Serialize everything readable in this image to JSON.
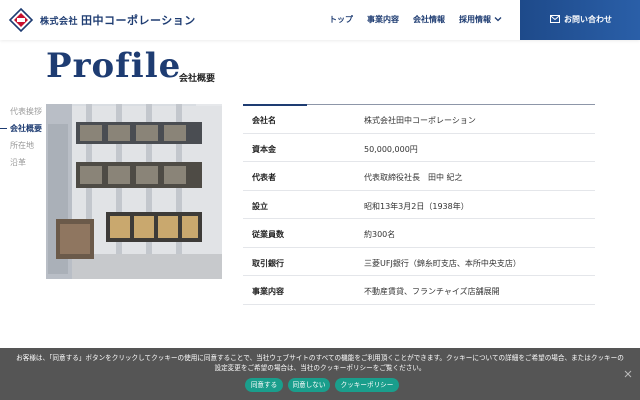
{
  "header": {
    "company_prefix": "株式会社",
    "company_name": "田中コーポレーション",
    "nav": [
      "トップ",
      "事業内容",
      "会社情報",
      "採用情報"
    ],
    "contact_label": "お問い合わせ"
  },
  "page": {
    "title": "Profile",
    "subtitle": "会社概要"
  },
  "side_nav": {
    "items": [
      "代表挨拶",
      "会社概要",
      "所在地",
      "沿革"
    ],
    "active_index": 1
  },
  "profile": {
    "rows": [
      {
        "label": "会社名",
        "value": "株式会社田中コーポレーション"
      },
      {
        "label": "資本金",
        "value": "50,000,000円"
      },
      {
        "label": "代表者",
        "value": "代表取締役社長　田中 紀之"
      },
      {
        "label": "設立",
        "value": "昭和13年3月2日（1938年）"
      },
      {
        "label": "従業員数",
        "value": "約300名"
      },
      {
        "label": "取引銀行",
        "value": "三菱UFJ銀行（錦糸町支店、本所中央支店）"
      },
      {
        "label": "事業内容",
        "value": "不動産賃貸、フランチャイズ店舗展開"
      }
    ]
  },
  "cookie": {
    "message": "お客様は、「同意する」ボタンをクリックしてクッキーの使用に同意することで、当社ウェブサイトのすべての機能をご利用頂くことができます。クッキーについての詳細をご希望の場合、またはクッキーの設定変更をご希望の場合は、当社のクッキーポリシーをご覧ください。",
    "agree_label": "同意する",
    "disagree_label": "同意しない",
    "policy_label": "クッキーポリシー"
  },
  "colors": {
    "brand": "#1e3c72",
    "cookie_button": "#1a9e8c"
  }
}
